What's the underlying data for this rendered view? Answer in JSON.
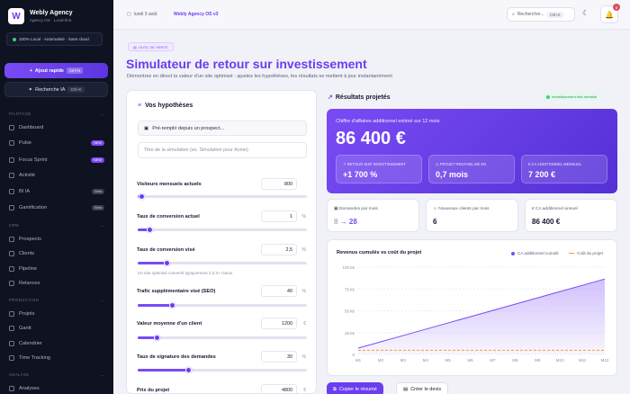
{
  "app": {
    "name": "Webly Agency",
    "subtitle": "Agency OS · Local-first",
    "logo_letter": "W"
  },
  "status_pill": "100% Local · Automatisé · Sans cloud",
  "quick_action": {
    "label": "Ajout rapide",
    "shortcut": "Ctrl+N"
  },
  "ai_search": {
    "label": "Recherche IA",
    "shortcut": "Ctrl+K"
  },
  "sections": {
    "pilotage": "PILOTAGE",
    "crm": "CRM",
    "production": "PRODUCTION",
    "analyse": "ANALYSE"
  },
  "nav": {
    "dashboard": "Dashboard",
    "pulse": "Pulse",
    "focus": "Focus Sprint",
    "activite": "Activité",
    "bi": "BI IA",
    "gamification": "Gamification",
    "prospects": "Prospects",
    "clients": "Clients",
    "pipeline": "Pipeline",
    "relances": "Relances",
    "projets": "Projets",
    "gantt": "Gantt",
    "calendrier": "Calendrier",
    "time": "Time Tracking",
    "analyses": "Analyses"
  },
  "badges": {
    "new": "NEW",
    "beta": "Beta"
  },
  "topbar": {
    "date": "lundi 3 août",
    "version": "Webly Agency OS v3",
    "search": "Rechercher...",
    "search_kbd": "Ctrl+K",
    "notifications": "8"
  },
  "header": {
    "tag": "OUTIL DE VENTE",
    "title": "Simulateur de retour sur investissement",
    "subtitle": "Démontrez en direct la valeur d'un site optimisé : ajustez les hypothèses, les résultats se mettent à jour instantanément"
  },
  "form": {
    "title": "Vos hypothèses",
    "prefill": "Pré-remplir depuis un prospect...",
    "sim_placeholder": "Titre de la simulation (ex. Simulation pour Acme)",
    "fields": [
      {
        "label": "Visiteurs mensuels actuels",
        "value": "800",
        "unit": "",
        "level": 0.02
      },
      {
        "label": "Taux de conversion actuel",
        "value": "1",
        "unit": "%",
        "level": 0.07
      },
      {
        "label": "Taux de conversion visé",
        "value": "2,5",
        "unit": "%",
        "level": 0.17
      },
      {
        "label": "Trafic supplémentaire visé (SEO)",
        "value": "40",
        "unit": "%",
        "level": 0.2
      },
      {
        "label": "Valeur moyenne d'un client",
        "value": "1200",
        "unit": "€",
        "level": 0.11
      },
      {
        "label": "Taux de signature des demandes",
        "value": "30",
        "unit": "%",
        "level": 0.3
      },
      {
        "label": "Prix du projet",
        "value": "4800",
        "unit": "€",
        "level": 0.3
      }
    ],
    "hint": "Un site optimisé convertit typiquement 2 à 3+ mieux"
  },
  "results": {
    "title": "Résultats projetés",
    "badge": "Investissement très rentable",
    "hero_label": "Chiffre d'affaires additionnel estimé sur 12 mois",
    "hero_value": "86 400 €",
    "roi_label": "RETOUR SUR INVESTISSEMENT",
    "roi_value": "+1 700 %",
    "payback_label": "PROJET RENTABILISÉ EN",
    "payback_value": "0,7 mois",
    "monthly_label": "CA ADDITIONNEL MENSUEL",
    "monthly_value": "7 200 €",
    "demandes_label": "Demandes par mois",
    "demandes_from": "8",
    "demandes_to": "28",
    "clients_label": "Nouveaux clients par mois",
    "clients_value": "6",
    "annual_label": "CA additionnel annuel",
    "annual_value": "86 400 €"
  },
  "chart_data": {
    "type": "area",
    "title": "Revenus cumulés vs coût du projet",
    "x": [
      "M1",
      "M2",
      "M3",
      "M4",
      "M5",
      "M6",
      "M7",
      "M8",
      "M9",
      "M10",
      "M11",
      "M12"
    ],
    "series": [
      {
        "name": "CA additionnel cumulé",
        "values": [
          7200,
          14400,
          21600,
          28800,
          36000,
          43200,
          50400,
          57600,
          64800,
          72000,
          79200,
          86400
        ],
        "color": "#7a4bf5"
      },
      {
        "name": "Coût du projet",
        "values": [
          4800,
          4800,
          4800,
          4800,
          4800,
          4800,
          4800,
          4800,
          4800,
          4800,
          4800,
          4800
        ],
        "color": "#f39a3c"
      }
    ],
    "yticks": [
      "0",
      "25 k€",
      "50 k€",
      "75 k€",
      "100 k€"
    ],
    "ylim": [
      0,
      100000
    ]
  },
  "actions": {
    "copy": "Copier le résumé",
    "quote": "Créer le devis"
  }
}
